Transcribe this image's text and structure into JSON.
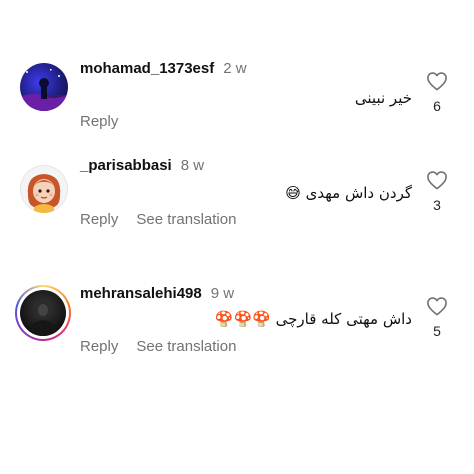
{
  "comments": [
    {
      "username": "mohamad_1373esf",
      "time": "2 w",
      "text": "خیر نبینی",
      "reply": "Reply",
      "likes": "6",
      "avatar": "night-scene-avatar"
    },
    {
      "username": "_parisabbasi",
      "time": "8 w",
      "text": "گردن داش مهدی 😅",
      "reply": "Reply",
      "see_translation": "See translation",
      "likes": "3",
      "avatar": "cartoon-girl-avatar"
    },
    {
      "username": "mehransalehi498",
      "time": "9 w",
      "text": "داش مهتی کله قارچی 🍄🍄🍄",
      "reply": "Reply",
      "see_translation": "See translation",
      "likes": "5",
      "avatar": "dark-portrait-story-ring-avatar"
    }
  ],
  "colors": {
    "secondary_text": "#737373",
    "story_ring_start": "#feda75",
    "story_ring_mid": "#d62976",
    "story_ring_end": "#962fbf"
  }
}
